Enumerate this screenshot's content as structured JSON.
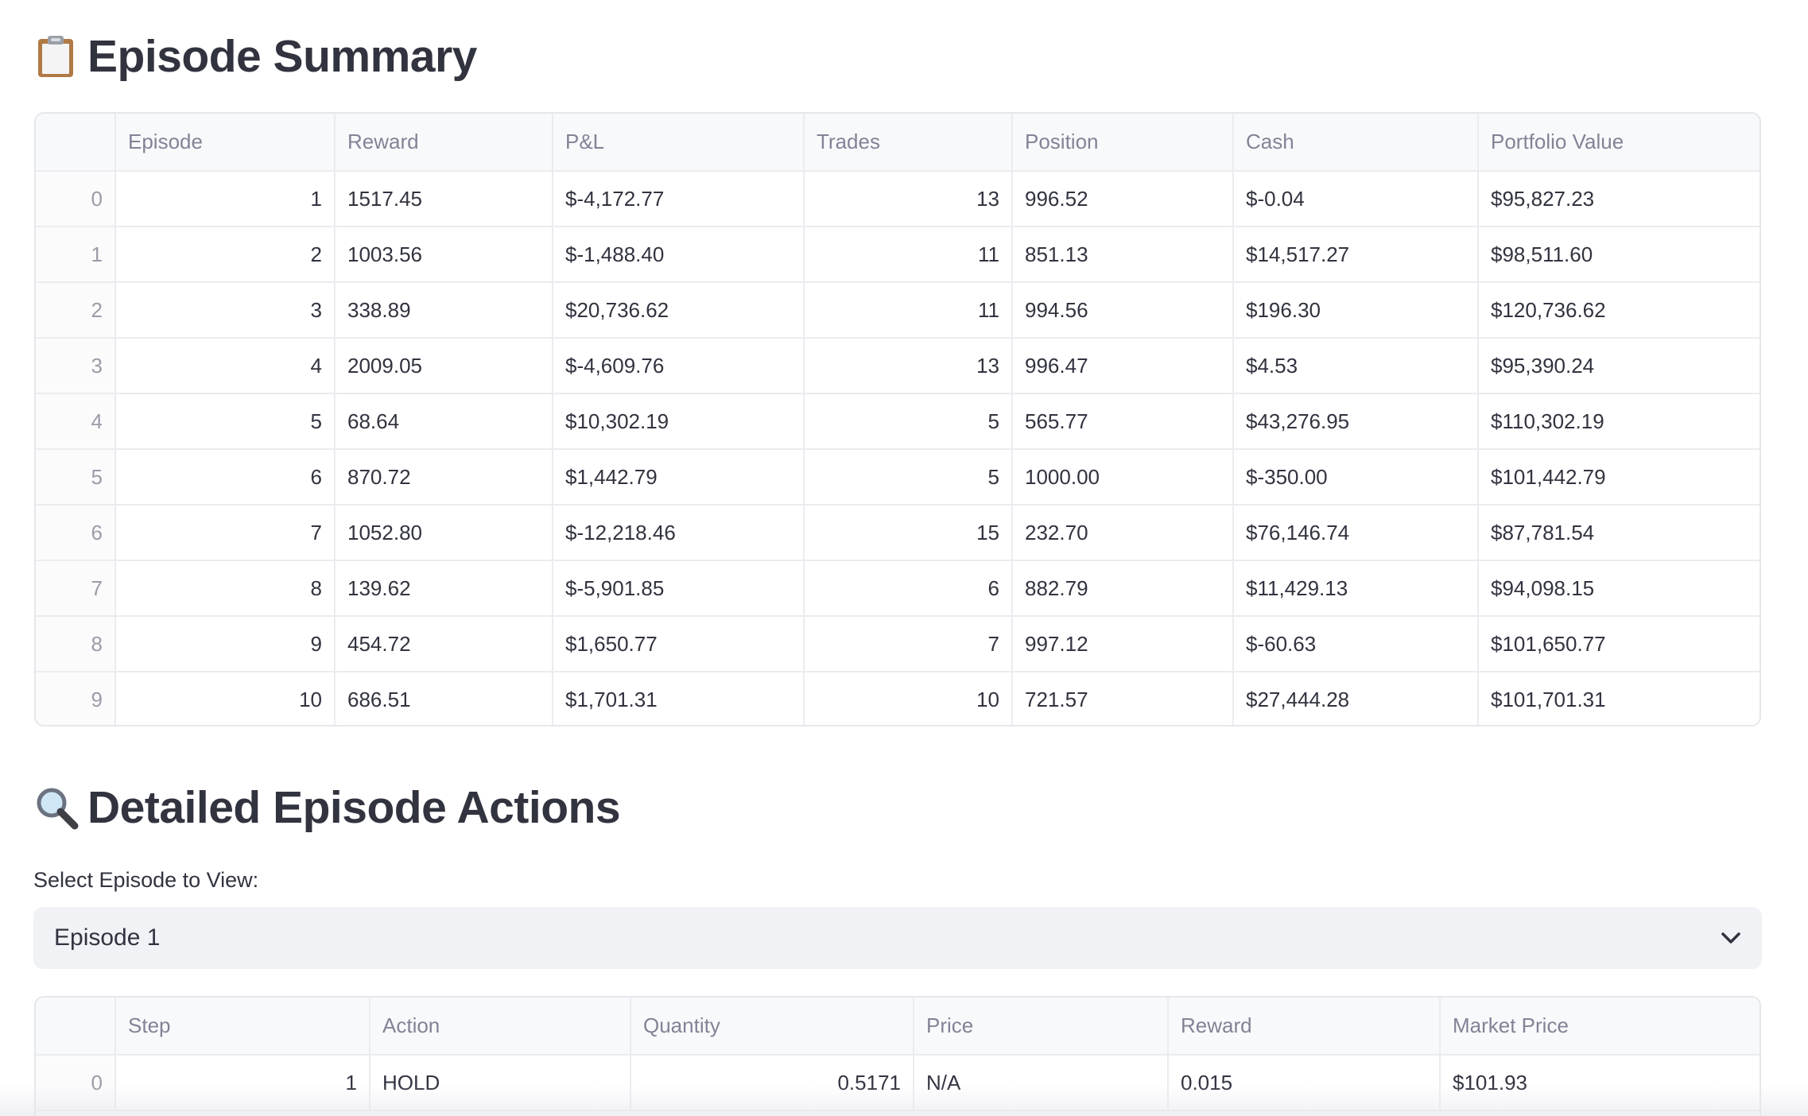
{
  "summary": {
    "emoji_icon": "clipboard-icon",
    "title": "Episode Summary",
    "columns": [
      "",
      "Episode",
      "Reward",
      "P&L",
      "Trades",
      "Position",
      "Cash",
      "Portfolio Value"
    ],
    "rows": [
      [
        "0",
        "1",
        "1517.45",
        "$-4,172.77",
        "13",
        "996.52",
        "$-0.04",
        "$95,827.23"
      ],
      [
        "1",
        "2",
        "1003.56",
        "$-1,488.40",
        "11",
        "851.13",
        "$14,517.27",
        "$98,511.60"
      ],
      [
        "2",
        "3",
        "338.89",
        "$20,736.62",
        "11",
        "994.56",
        "$196.30",
        "$120,736.62"
      ],
      [
        "3",
        "4",
        "2009.05",
        "$-4,609.76",
        "13",
        "996.47",
        "$4.53",
        "$95,390.24"
      ],
      [
        "4",
        "5",
        "68.64",
        "$10,302.19",
        "5",
        "565.77",
        "$43,276.95",
        "$110,302.19"
      ],
      [
        "5",
        "6",
        "870.72",
        "$1,442.79",
        "5",
        "1000.00",
        "$-350.00",
        "$101,442.79"
      ],
      [
        "6",
        "7",
        "1052.80",
        "$-12,218.46",
        "15",
        "232.70",
        "$76,146.74",
        "$87,781.54"
      ],
      [
        "7",
        "8",
        "139.62",
        "$-5,901.85",
        "6",
        "882.79",
        "$11,429.13",
        "$94,098.15"
      ],
      [
        "8",
        "9",
        "454.72",
        "$1,650.77",
        "7",
        "997.12",
        "$-60.63",
        "$101,650.77"
      ],
      [
        "9",
        "10",
        "686.51",
        "$1,701.31",
        "10",
        "721.57",
        "$27,444.28",
        "$101,701.31"
      ]
    ]
  },
  "actions": {
    "emoji_icon": "magnifying-glass-icon",
    "title": "Detailed Episode Actions",
    "select_label": "Select Episode to View:",
    "select_value": "Episode 1",
    "columns": [
      "",
      "Step",
      "Action",
      "Quantity",
      "Price",
      "Reward",
      "Market Price"
    ],
    "rows": [
      [
        "0",
        "1",
        "HOLD",
        "0.5171",
        "N/A",
        "0.015",
        "$101.93"
      ]
    ]
  }
}
